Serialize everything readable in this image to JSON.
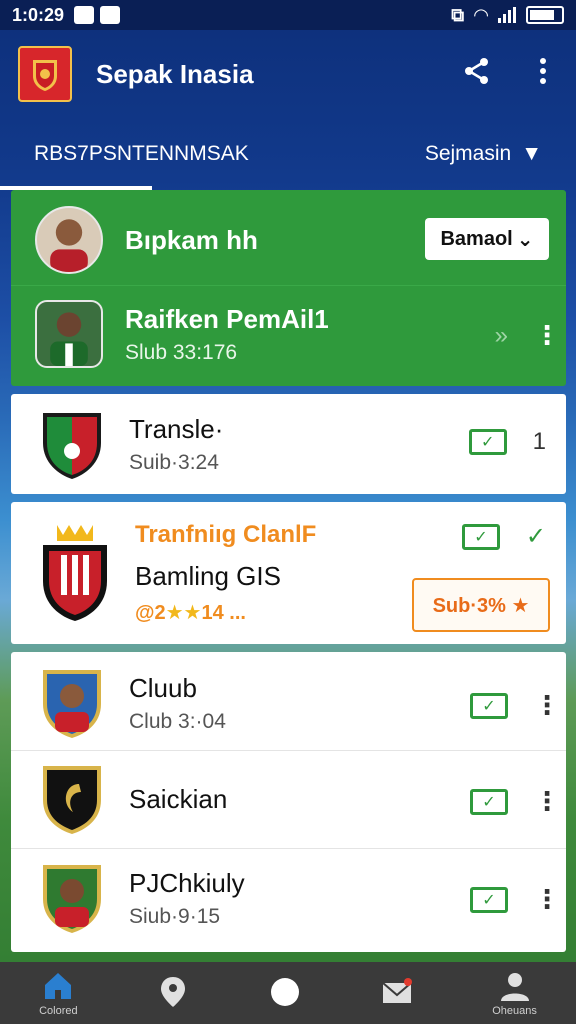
{
  "status_bar": {
    "time": "1:0:29"
  },
  "app_bar": {
    "title": "Sepak Inasia"
  },
  "tabs": {
    "main": "RBS7PSNTENNMSAK",
    "sort": "Sejmasin"
  },
  "featured": {
    "name": "Bıpkam hh",
    "dropdown": "Bamaol"
  },
  "items": [
    {
      "name": "Raifken PemAil1",
      "sub": "Slub 33:176"
    },
    {
      "name": "Transle·",
      "sub": "Suib·3:24",
      "count": "1"
    },
    {
      "title": "Tranfniıg ClanlF",
      "name": "Bamling GIS",
      "rating_prefix": "@2",
      "stars": "★★",
      "rating_suffix": "14 ...",
      "badge": "Sub·3% ★"
    },
    {
      "name": "Cluub",
      "sub": "Club 3:·04"
    },
    {
      "name": "Saickian",
      "sub": ""
    },
    {
      "name": "PJChkiuly",
      "sub": "Siub·9·15"
    }
  ],
  "bottom_nav": [
    {
      "icon": "home-icon",
      "label": "Colored"
    },
    {
      "icon": "location-icon",
      "label": ""
    },
    {
      "icon": "circle-icon",
      "label": ""
    },
    {
      "icon": "mail-icon",
      "label": ""
    },
    {
      "icon": "profile-icon",
      "label": "Oheuans"
    }
  ],
  "colors": {
    "primary_blue": "#0d2f7a",
    "green": "#2f9a3c",
    "orange": "#f08c1f",
    "nav_dark": "#3a3a3a"
  }
}
